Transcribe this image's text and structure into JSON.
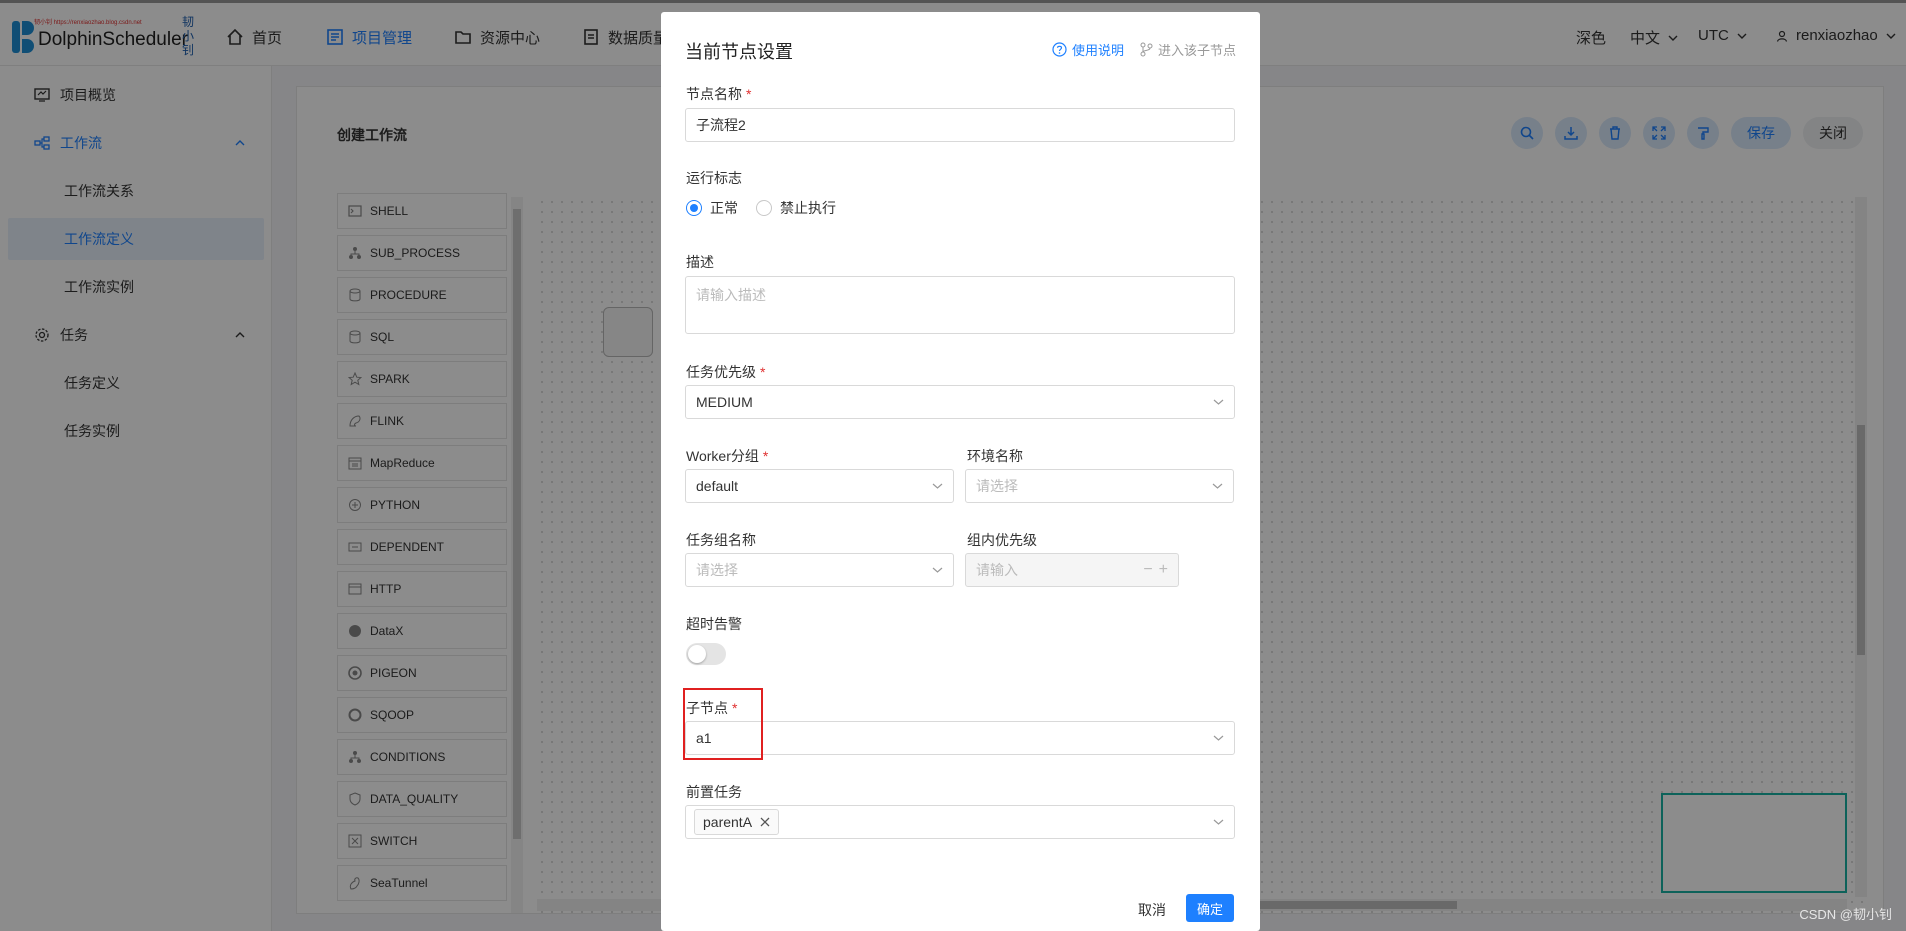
{
  "logo": {
    "text": "DolphinScheduler",
    "watermark": "韧小钊 https://renxiaozhao.blog.csdn.net",
    "cn": "韧小钊"
  },
  "nav": [
    {
      "label": "首页",
      "icon": "home-icon",
      "active": false
    },
    {
      "label": "项目管理",
      "icon": "project-icon",
      "active": true
    },
    {
      "label": "资源中心",
      "icon": "folder-icon",
      "active": false
    },
    {
      "label": "数据质量",
      "icon": "quality-icon",
      "active": false
    }
  ],
  "header_right": {
    "theme": "深色",
    "lang": "中文",
    "timezone": "UTC",
    "user": "renxiaozhao"
  },
  "sidebar": {
    "overview": "项目概览",
    "workflow": "工作流",
    "workflow_items": [
      "工作流关系",
      "工作流定义",
      "工作流实例"
    ],
    "task": "任务",
    "task_items": [
      "任务定义",
      "任务实例"
    ]
  },
  "main": {
    "title": "创建工作流",
    "save": "保存",
    "close": "关闭",
    "palette": [
      "SHELL",
      "SUB_PROCESS",
      "PROCEDURE",
      "SQL",
      "SPARK",
      "FLINK",
      "MapReduce",
      "PYTHON",
      "DEPENDENT",
      "HTTP",
      "DataX",
      "PIGEON",
      "SQOOP",
      "CONDITIONS",
      "DATA_QUALITY",
      "SWITCH",
      "SeaTunnel"
    ]
  },
  "modal": {
    "title": "当前节点设置",
    "help_link": "使用说明",
    "enter_link": "进入该子节点",
    "node_name_label": "节点名称",
    "node_name_value": "子流程2",
    "run_flag_label": "运行标志",
    "run_flag_normal": "正常",
    "run_flag_forbid": "禁止执行",
    "desc_label": "描述",
    "desc_placeholder": "请输入描述",
    "priority_label": "任务优先级",
    "priority_value": "MEDIUM",
    "worker_label": "Worker分组",
    "worker_value": "default",
    "env_label": "环境名称",
    "env_placeholder": "请选择",
    "taskgroup_label": "任务组名称",
    "taskgroup_placeholder": "请选择",
    "group_priority_label": "组内优先级",
    "group_priority_placeholder": "请输入",
    "timeout_label": "超时告警",
    "child_node_label": "子节点",
    "child_node_value": "a1",
    "pre_task_label": "前置任务",
    "pre_task_tag": "parentA",
    "cancel": "取消",
    "confirm": "确定"
  },
  "footer_watermark": "CSDN @韧小钊"
}
